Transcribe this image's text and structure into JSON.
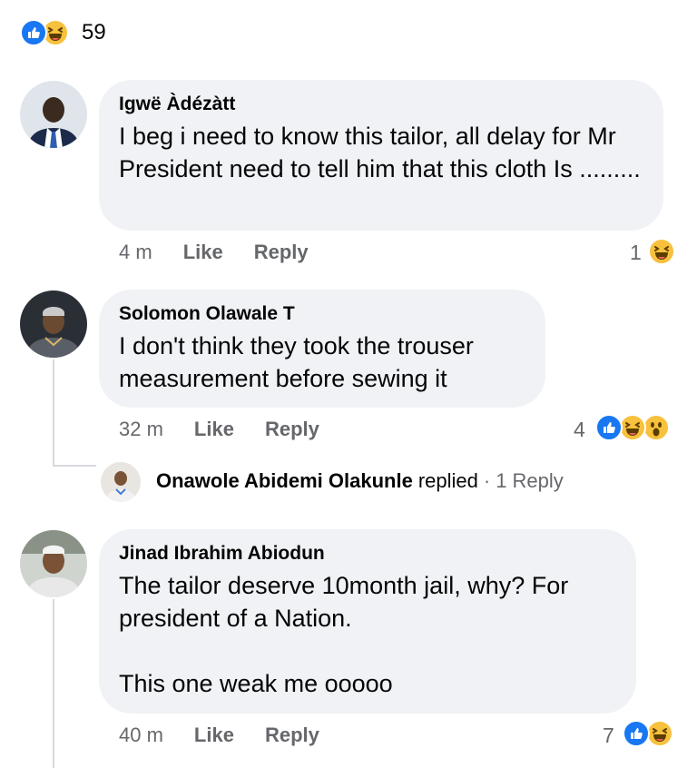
{
  "post_reactions": {
    "count": "59",
    "icons": [
      "like-icon",
      "haha-icon"
    ]
  },
  "comments": [
    {
      "author": "Igwë Àdézàtt",
      "text": "I beg i need to know this tailor, all delay for Mr President need to tell him that this cloth Is .........",
      "time": "4 m",
      "like": "Like",
      "reply": "Reply",
      "reaction_count": "1",
      "reactions": [
        "haha-icon"
      ]
    },
    {
      "author": "Solomon Olawale T",
      "text": "I don't think they took the trouser measurement before sewing it",
      "time": "32 m",
      "like": "Like",
      "reply": "Reply",
      "reaction_count": "4",
      "reactions": [
        "like-icon",
        "haha-icon",
        "wow-icon"
      ],
      "reply_summary": {
        "name": "Onawole Abidemi Olakunle",
        "verb": "replied",
        "sep": "·",
        "count": "1 Reply"
      }
    },
    {
      "author": "Jinad Ibrahim Abiodun",
      "text": "The tailor deserve 10month jail, why? For president of a Nation.\n\nThis one weak me ooooo",
      "time": "40 m",
      "like": "Like",
      "reply": "Reply",
      "reaction_count": "7",
      "reactions": [
        "like-icon",
        "haha-icon"
      ]
    }
  ],
  "colors": {
    "like": "#1877f2",
    "haha": "#f7c13d",
    "bubble": "#f0f2f5",
    "meta": "#65676b"
  }
}
